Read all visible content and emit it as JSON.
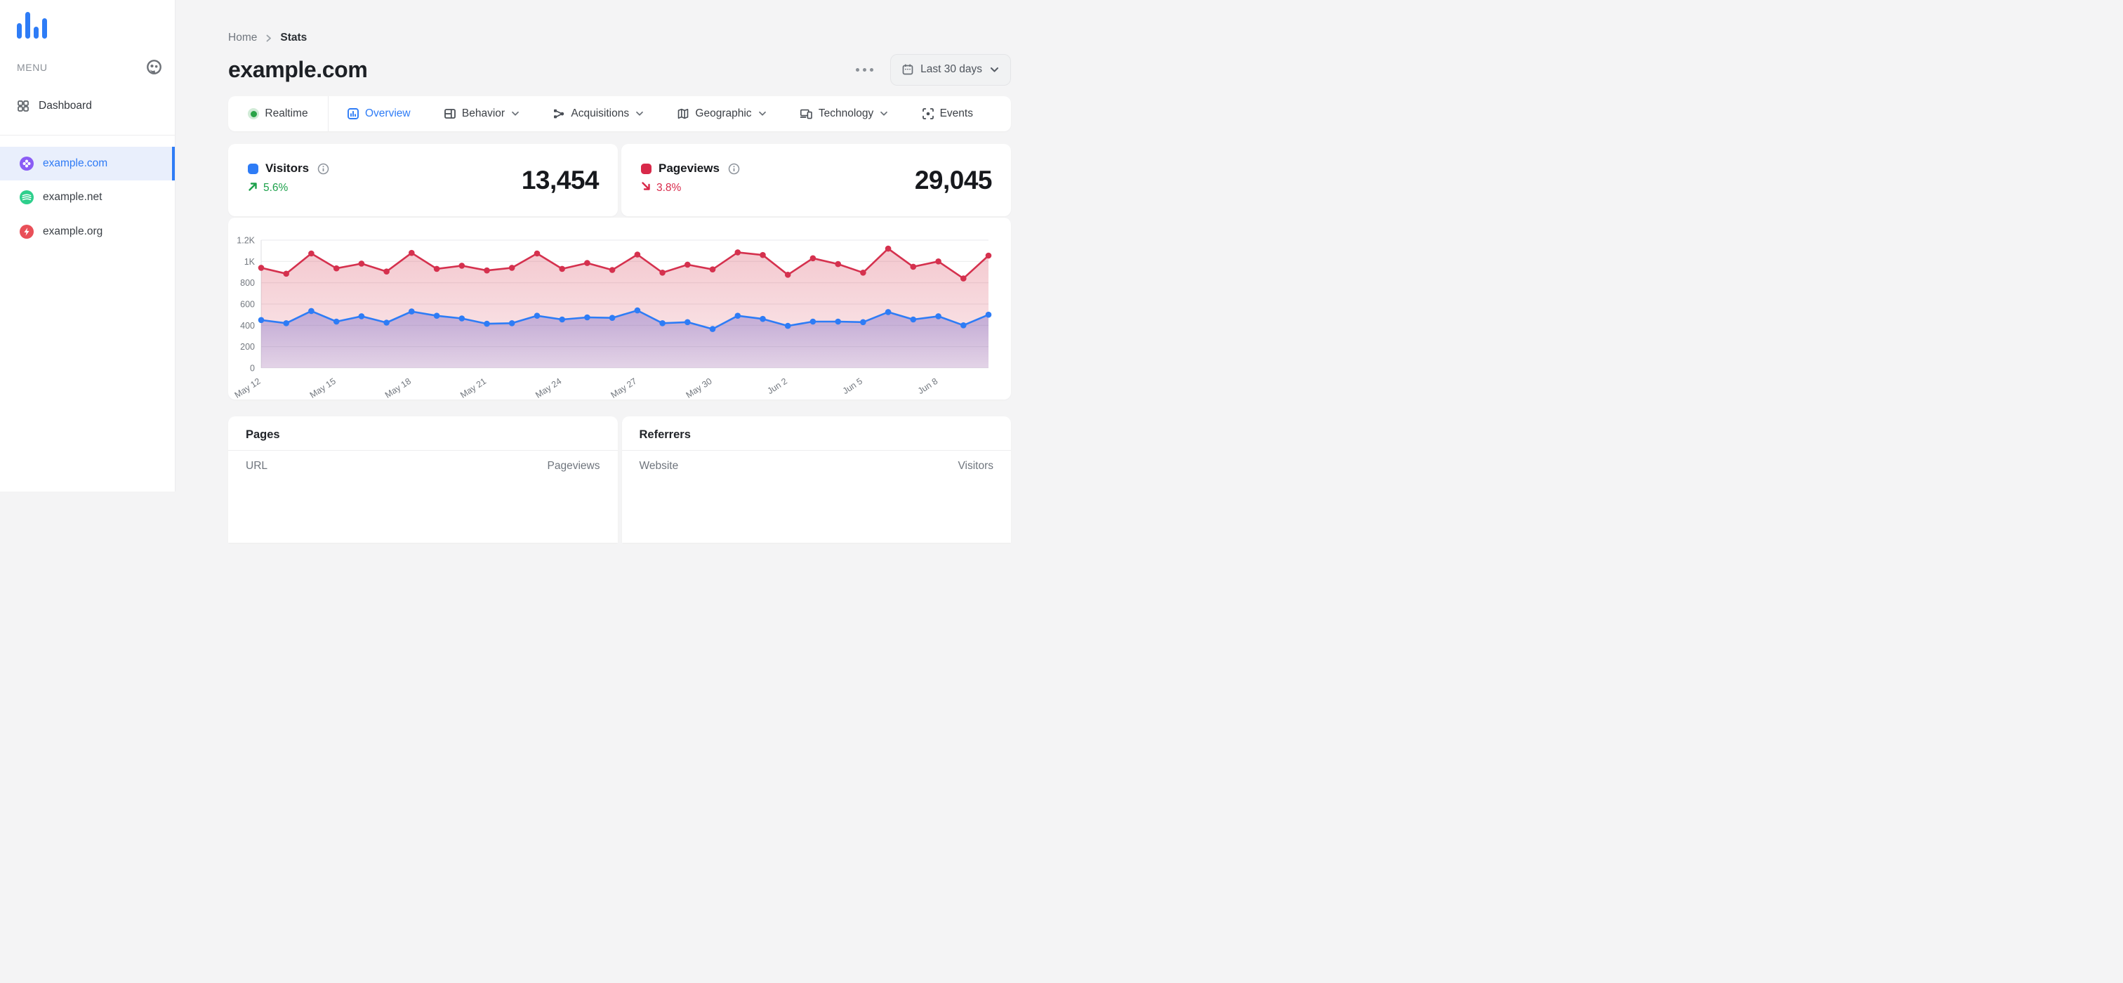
{
  "sidebar": {
    "menu_label": "MENU",
    "nav": [
      {
        "label": "Dashboard"
      }
    ],
    "sites": [
      {
        "label": "example.com",
        "icon": "clover",
        "icon_color": "#8a5cf5",
        "active": true
      },
      {
        "label": "example.net",
        "icon": "waves",
        "icon_color": "#2ecf8c",
        "active": false
      },
      {
        "label": "example.org",
        "icon": "bolt",
        "icon_color": "#e94f58",
        "active": false
      }
    ]
  },
  "breadcrumb": {
    "home": "Home",
    "current": "Stats"
  },
  "header": {
    "title": "example.com",
    "date_range": "Last 30 days"
  },
  "tabs": [
    {
      "label": "Realtime",
      "active": false,
      "dropdown": false
    },
    {
      "label": "Overview",
      "active": true,
      "dropdown": false
    },
    {
      "label": "Behavior",
      "active": false,
      "dropdown": true
    },
    {
      "label": "Acquisitions",
      "active": false,
      "dropdown": true
    },
    {
      "label": "Geographic",
      "active": false,
      "dropdown": true
    },
    {
      "label": "Technology",
      "active": false,
      "dropdown": true
    },
    {
      "label": "Events",
      "active": false,
      "dropdown": false
    }
  ],
  "stats": [
    {
      "label": "Visitors",
      "value": "13,454",
      "trend": "5.6%",
      "trend_direction": "up",
      "swatch_color": "#2e7cf6",
      "trend_color": "#1da14b"
    },
    {
      "label": "Pageviews",
      "value": "29,045",
      "trend": "3.8%",
      "trend_direction": "down",
      "swatch_color": "#d8294a",
      "trend_color": "#d8294a"
    }
  ],
  "chart_data": {
    "type": "line",
    "title": "Visitors and Pageviews, last 30 days",
    "x": [
      "May 12",
      "May 13",
      "May 14",
      "May 15",
      "May 16",
      "May 17",
      "May 18",
      "May 19",
      "May 20",
      "May 21",
      "May 22",
      "May 23",
      "May 24",
      "May 25",
      "May 26",
      "May 27",
      "May 28",
      "May 29",
      "May 30",
      "May 31",
      "Jun 1",
      "Jun 2",
      "Jun 3",
      "Jun 4",
      "Jun 5",
      "Jun 6",
      "Jun 7",
      "Jun 8",
      "Jun 9",
      "Jun 10"
    ],
    "xtick_every": 3,
    "series": [
      {
        "name": "Pageviews",
        "color": "#d5314e",
        "fill_top": "rgba(214,58,82,0.28)",
        "fill_bottom": "rgba(214,58,82,0.10)",
        "values": [
          940,
          885,
          1075,
          935,
          980,
          905,
          1080,
          930,
          960,
          915,
          940,
          1075,
          930,
          985,
          920,
          1065,
          895,
          970,
          925,
          1085,
          1060,
          875,
          1030,
          975,
          895,
          1120,
          950,
          1000,
          840,
          1055
        ]
      },
      {
        "name": "Visitors",
        "color": "#2e7cf6",
        "fill_top": "rgba(104,88,196,0.38)",
        "fill_bottom": "rgba(104,88,196,0.16)",
        "values": [
          450,
          420,
          535,
          435,
          485,
          425,
          530,
          490,
          465,
          415,
          420,
          490,
          455,
          475,
          470,
          540,
          420,
          430,
          365,
          490,
          460,
          395,
          435,
          435,
          430,
          525,
          455,
          485,
          400,
          500
        ]
      }
    ],
    "ylim": [
      0,
      1200
    ],
    "ytick_values": [
      0,
      200,
      400,
      600,
      800,
      1000,
      1200
    ],
    "ytick_labels": [
      "0",
      "200",
      "400",
      "600",
      "800",
      "1K",
      "1.2K"
    ],
    "grid": true,
    "legend_position": "none"
  },
  "tables": [
    {
      "title": "Pages",
      "columns": [
        "URL",
        "Pageviews"
      ]
    },
    {
      "title": "Referrers",
      "columns": [
        "Website",
        "Visitors"
      ]
    }
  ],
  "colors": {
    "accent_blue": "#2e7cf6",
    "accent_red": "#d8294a",
    "trend_green": "#1da14b",
    "realtime_green": "#2aa348",
    "active_row_bg": "#e9effc",
    "page_bg": "#f4f4f5"
  }
}
